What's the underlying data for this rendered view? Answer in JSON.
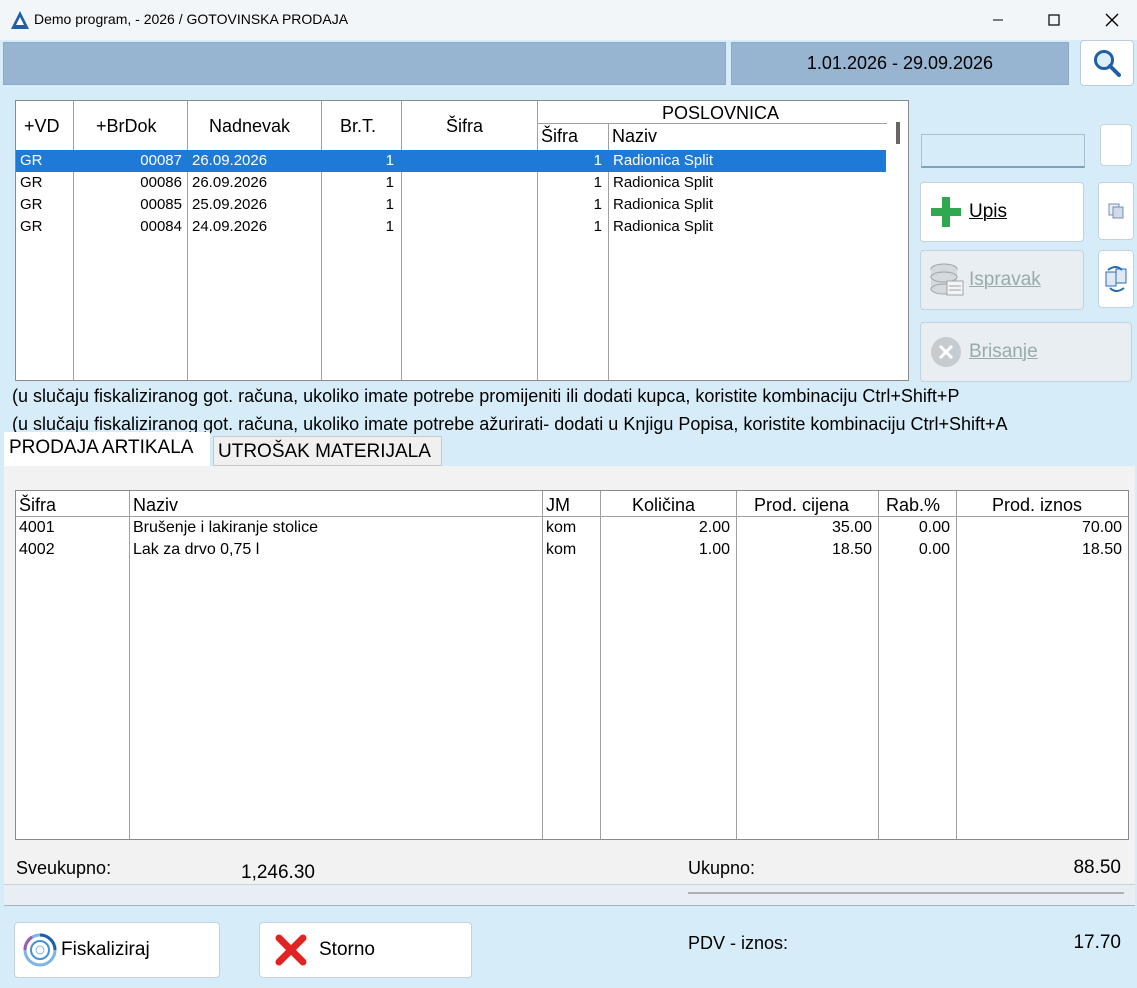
{
  "window": {
    "title": "Demo program, - 2026 / GOTOVINSKA PRODAJA"
  },
  "header": {
    "date_range": "1.01.2026 - 29.09.2026"
  },
  "doc_grid": {
    "headers": {
      "vd": "+VD",
      "brdok": "+BrDok",
      "nadnevak": "Nadnevak",
      "brt": "Br.T.",
      "sifra": "Šifra",
      "poslovnica": "POSLOVNICA",
      "pos_sifra": "Šifra",
      "pos_naziv": "Naziv"
    },
    "rows": [
      {
        "vd": "GR",
        "brdok": "00087",
        "nadnevak": "26.09.2026",
        "brt": "1",
        "sifra": "",
        "pos_sifra": "1",
        "pos_naziv": "Radionica Split"
      },
      {
        "vd": "GR",
        "brdok": "00086",
        "nadnevak": "26.09.2026",
        "brt": "1",
        "sifra": "",
        "pos_sifra": "1",
        "pos_naziv": "Radionica Split"
      },
      {
        "vd": "GR",
        "brdok": "00085",
        "nadnevak": "25.09.2026",
        "brt": "1",
        "sifra": "",
        "pos_sifra": "1",
        "pos_naziv": "Radionica Split"
      },
      {
        "vd": "GR",
        "brdok": "00084",
        "nadnevak": "24.09.2026",
        "brt": "1",
        "sifra": "",
        "pos_sifra": "1",
        "pos_naziv": "Radionica Split"
      }
    ]
  },
  "actions": {
    "upis": "Upis",
    "ispravak": "Ispravak",
    "brisanje": "Brisanje"
  },
  "notes": {
    "line1": " (u slučaju fiskaliziranog got. računa, ukoliko imate potrebe promijeniti ili dodati kupca, koristite kombinaciju Ctrl+Shift+P",
    "line2": "(u slučaju fiskaliziranog got. računa, ukoliko imate potrebe ažurirati- dodati u Knjigu Popisa, koristite kombinaciju Ctrl+Shift+A"
  },
  "tabs": {
    "prodaja": "PRODAJA ARTIKALA",
    "utrosak": "UTROŠAK MATERIJALA"
  },
  "items_grid": {
    "headers": {
      "sifra": "Šifra",
      "naziv": "Naziv",
      "jm": "JM",
      "kolicina": "Količina",
      "cijena": "Prod. cijena",
      "rabat": "Rab.%",
      "iznos": "Prod. iznos"
    },
    "rows": [
      {
        "sifra": "4001",
        "naziv": "Brušenje i lakiranje stolice",
        "jm": "kom",
        "kolicina": "2.00",
        "cijena": "35.00",
        "rabat": "0.00",
        "iznos": "70.00"
      },
      {
        "sifra": "4002",
        "naziv": "Lak za drvo 0,75 l",
        "jm": "kom",
        "kolicina": "1.00",
        "cijena": "18.50",
        "rabat": "0.00",
        "iznos": "18.50"
      }
    ]
  },
  "totals": {
    "sveukupno_label": "Sveukupno:",
    "sveukupno_value": "1,246.30",
    "ukupno_label": "Ukupno:",
    "ukupno_value": "88.50",
    "pdv_label": "PDV - iznos:",
    "pdv_value": "17.70"
  },
  "bottom_buttons": {
    "fiskaliziraj": "Fiskaliziraj",
    "storno": "Storno"
  },
  "colors": {
    "background": "#d6ecf8",
    "header_bar": "#97b4d0",
    "selection": "#1e7ad6",
    "add_green": "#2fa84f",
    "storno_red": "#e02424"
  }
}
